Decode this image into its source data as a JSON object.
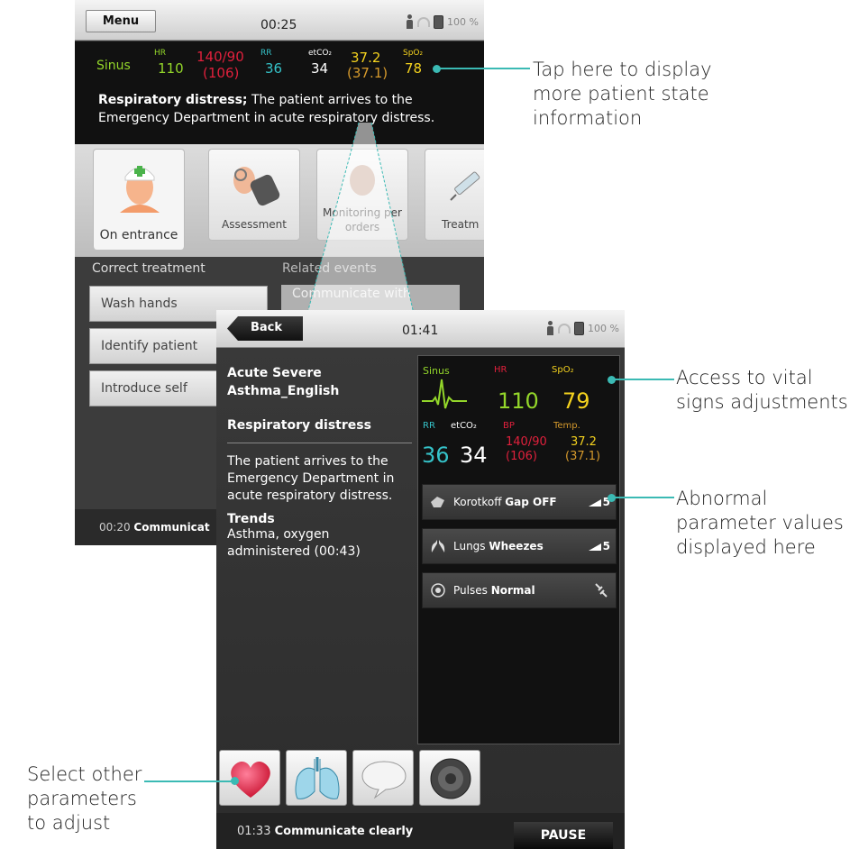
{
  "colors": {
    "callout": "#3bbab4",
    "green": "#93d62a",
    "yellow": "#f4d21e",
    "red": "#e0203c",
    "cyan": "#35c2c8",
    "orange": "#d69a2c"
  },
  "back_screen": {
    "menu_label": "Menu",
    "clock": "00:25",
    "battery": "100 %",
    "vitals": {
      "rhythm": "Sinus",
      "hr_label": "HR",
      "hr": "110",
      "bp": "140/90",
      "map": "(106)",
      "rr_label": "RR",
      "rr": "36",
      "etco2_label": "etCO₂",
      "etco2": "34",
      "temp": "37.2",
      "temp_sub": "(37.1)",
      "spo2_label": "SpO₂",
      "spo2": "78"
    },
    "state_title": "Respiratory distress;",
    "state_text": " The patient arrives to the Emergency Department in acute respiratory distress.",
    "tabs": [
      "On entrance",
      "Assessment",
      "Monitoring per orders",
      "Treatm"
    ],
    "correct_treatment_label": "Correct treatment",
    "related_events_label": "Related events",
    "treatments": [
      "Wash hands",
      "Identify patient",
      "Introduce self"
    ],
    "related_event": "Communicate with",
    "footer_time": "00:20",
    "footer_text": "Communicat"
  },
  "front_screen": {
    "back_label": "Back",
    "clock": "01:41",
    "battery": "100 %",
    "scenario": "Acute Severe Asthma_English",
    "state_title": "Respiratory distress",
    "state_text": "The patient arrives to the Emergency Department in acute respiratory distress.",
    "trends_title": "Trends",
    "trends_text": "Asthma, oxygen administered (00:43)",
    "vitals": {
      "rhythm": "Sinus",
      "hr_label": "HR",
      "hr": "110",
      "spo2_label": "SpO₂",
      "spo2": "79",
      "rr_label": "RR",
      "etco2_label": "etCO₂",
      "bp_label": "BP",
      "temp_label": "Temp.",
      "rr": "36",
      "etco2": "34",
      "bp": "140/90",
      "map": "(106)",
      "temp": "37.2",
      "temp_sub": "(37.1)"
    },
    "adjustments": [
      {
        "name": "Korotkoff",
        "value": "Gap OFF",
        "level": "5",
        "icon": "bp-cuff-icon"
      },
      {
        "name": "Lungs",
        "value": "Wheezes",
        "level": "5",
        "icon": "lungs-icon"
      },
      {
        "name": "Pulses",
        "value": "Normal",
        "level": "",
        "icon": "pulse-icon"
      }
    ],
    "param_icons": [
      "heart-icon",
      "lungs-icon",
      "speech-bubble-icon",
      "speaker-icon"
    ],
    "footer_time": "01:33",
    "footer_text": "Communicate clearly",
    "pause_label": "PAUSE"
  },
  "callouts": {
    "tap": "Tap here to display more patient state information",
    "access": "Access to vital signs adjustments",
    "abnormal": "Abnormal parameter values displayed here",
    "select": "Select other parameters to adjust"
  }
}
